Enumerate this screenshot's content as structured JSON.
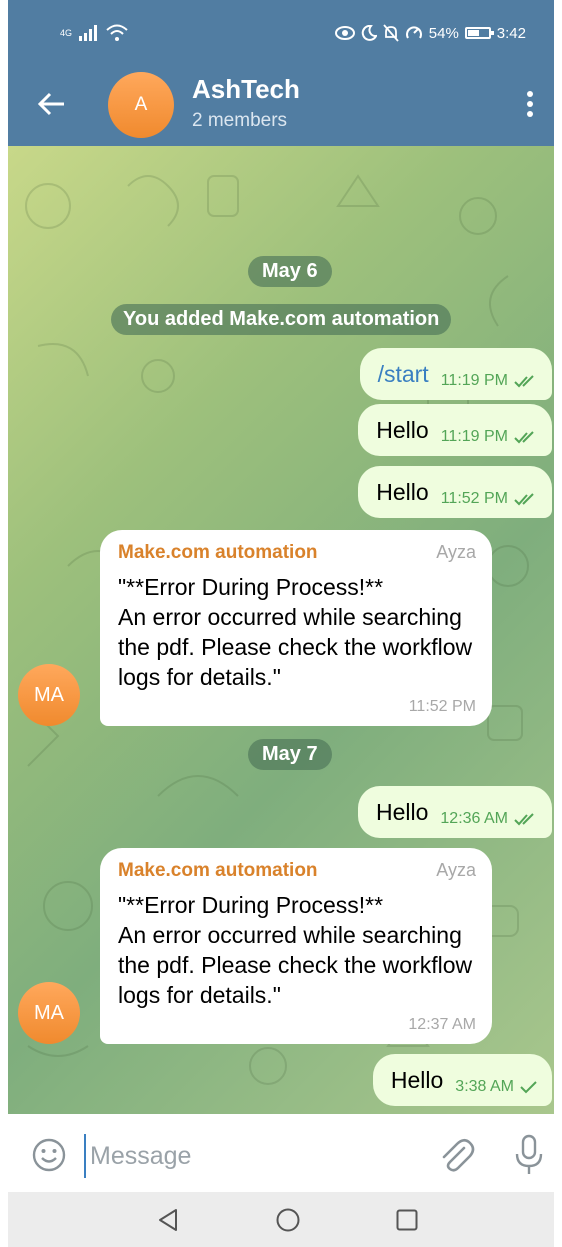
{
  "status_bar": {
    "network": "4G",
    "battery": "54%",
    "battery_level": 0.54,
    "time": "3:42"
  },
  "header": {
    "avatar_letter": "A",
    "title": "AshTech",
    "subtitle": "2 members",
    "accent": "#517da2"
  },
  "chat": {
    "dates": [
      "May 6",
      "May 7"
    ],
    "service_message": "You added Make.com automation",
    "messages": [
      {
        "text": "/start",
        "time": "11:19 PM"
      },
      {
        "text": "Hello",
        "time": "11:19 PM"
      },
      {
        "text": "Hello",
        "time": "11:52 PM"
      },
      {
        "sender": "Make.com automation",
        "role": "Ayza",
        "avatar": "MA",
        "text": "\"**Error During Process!**\n An error occurred while searching the pdf. Please check the workflow logs for details.\"",
        "time": "11:52 PM"
      },
      {
        "text": "Hello",
        "time": "12:36 AM"
      },
      {
        "sender": "Make.com automation",
        "role": "Ayza",
        "avatar": "MA",
        "text": "\"**Error During Process!**\n An error occurred while searching the pdf. Please check the workflow logs for details.\"",
        "time": "12:37 AM"
      },
      {
        "text": "Hello",
        "time": "3:38 AM"
      }
    ]
  },
  "composer": {
    "placeholder": "Message"
  },
  "icons": [
    "back-arrow-icon",
    "more-vert-icon",
    "emoji-icon",
    "paperclip-icon",
    "microphone-icon",
    "double-check-icon",
    "single-check-icon",
    "nav-back-icon",
    "nav-home-icon",
    "nav-recent-icon"
  ]
}
